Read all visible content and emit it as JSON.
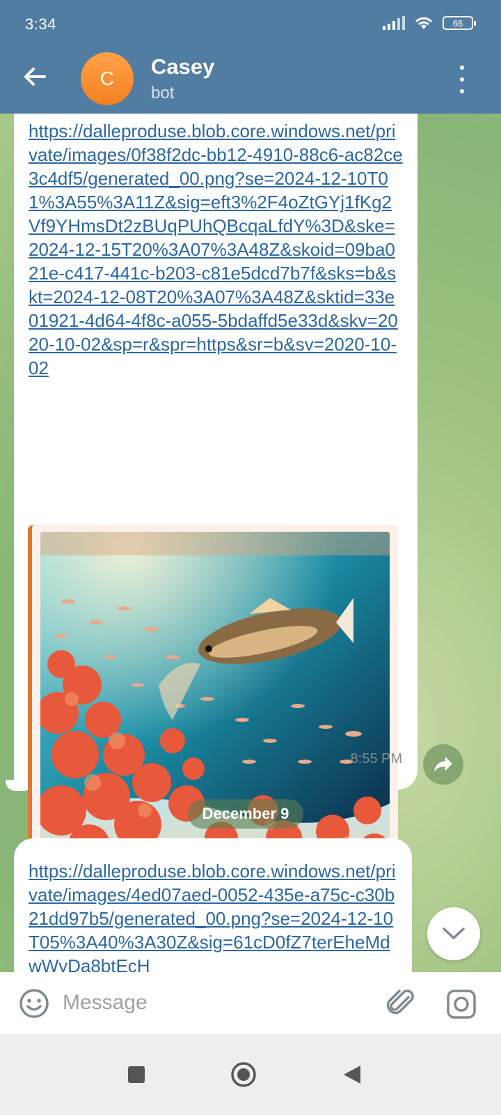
{
  "status_bar": {
    "time": "3:34",
    "battery": "66"
  },
  "header": {
    "avatar_letter": "C",
    "title": "Casey",
    "subtitle": "bot"
  },
  "messages": [
    {
      "link": "https://dalleproduse.blob.core.windows.net/private/images/0f38f2dc-bb12-4910-88c6-ac82ce3c4df5/generated_00.png?se=2024-12-10T01%3A55%3A11Z&sig=eft3%2F4oZtGYj1fKg2Vf9YHmsDt2zBUqPUhQBcqaLfdY%3D&ske=2024-12-15T20%3A07%3A48Z&skoid=09ba021e-c417-441c-b203-c81e5dcd7b7f&sks=b&skt=2024-12-08T20%3A07%3A48Z&sktid=33e01921-4d64-4f8c-a055-5bdaffd5e33d&skv=2020-10-02&sp=r&spr=https&sr=b&sv=2020-10-02",
      "time": "8:55 PM"
    },
    {
      "link": "https://dalleproduse.blob.core.windows.net/private/images/4ed07aed-0052-435e-a75c-c30b21dd97b5/generated_00.png?se=2024-12-10T05%3A40%3A30Z&sig=61cD0fZ7terEheMdwWyDa8btEcH"
    }
  ],
  "date_separator": "December 9",
  "input": {
    "placeholder": "Message",
    "value": ""
  },
  "colors": {
    "header": "#517da2",
    "link": "#2b67a4",
    "preview_accent": "#e4772a",
    "avatar": "#f4801f"
  },
  "icons": [
    "back-arrow-icon",
    "more-vert-icon",
    "forward-icon",
    "chevron-down-icon",
    "emoji-icon",
    "paperclip-icon",
    "camera-icon",
    "nav-recents-icon",
    "nav-home-icon",
    "nav-back-icon"
  ]
}
